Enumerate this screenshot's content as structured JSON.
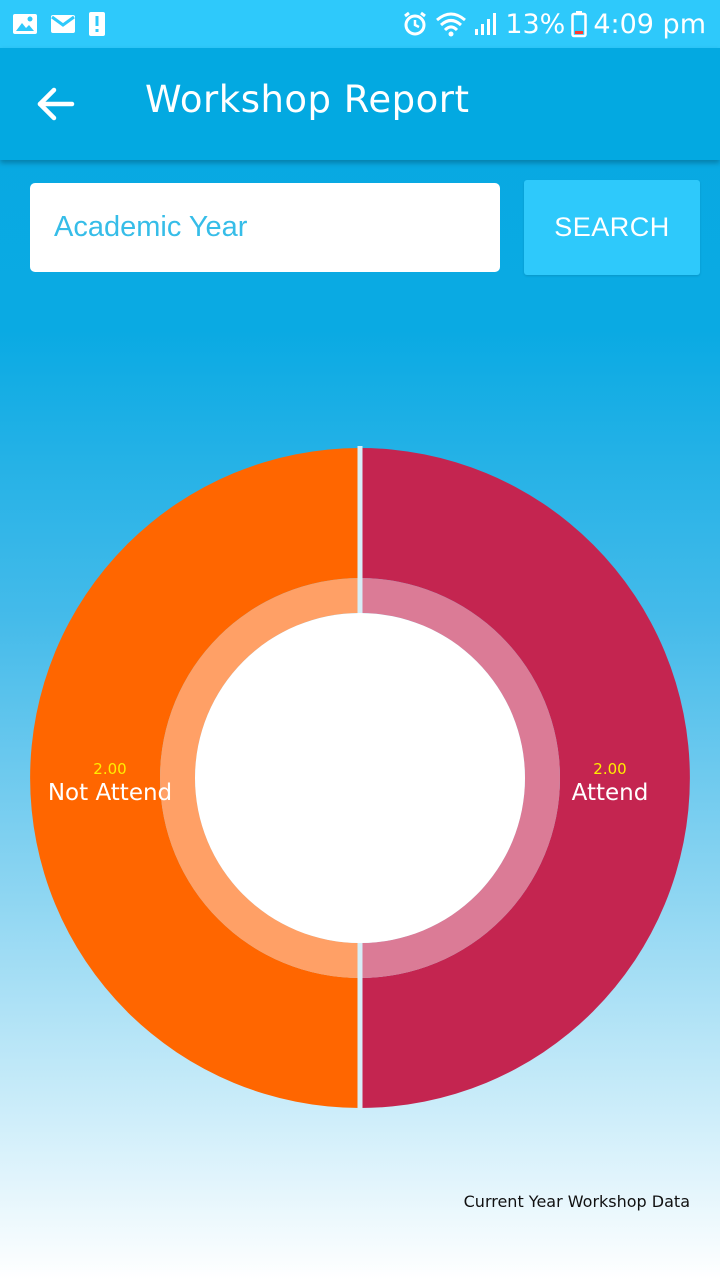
{
  "status_bar": {
    "battery_percent": "13%",
    "time": "4:09 pm",
    "icons": [
      "gallery-icon",
      "gmail-icon",
      "alert-icon",
      "alarm-icon",
      "wifi-icon",
      "signal-icon",
      "battery-icon"
    ]
  },
  "app_bar": {
    "title": "Workshop Report",
    "back_icon": "arrow-left-icon"
  },
  "search": {
    "placeholder": "Academic Year",
    "value": "",
    "button_label": "SEARCH"
  },
  "colors": {
    "app_bar": "#03a9e1",
    "status_bar": "#2ec9fb",
    "not_attend": "#ff6600",
    "not_attend_inner": "#ffa066",
    "attend": "#c42550",
    "attend_inner": "#db7b96",
    "value_label": "#ffee00"
  },
  "chart_data": {
    "type": "pie",
    "style": "donut",
    "slices": [
      {
        "label": "Attend",
        "value": 2.0,
        "value_label": "2.00",
        "color": "#c42550"
      },
      {
        "label": "Not Attend",
        "value": 2.0,
        "value_label": "2.00",
        "color": "#ff6600"
      }
    ],
    "center_text": ""
  },
  "footer": {
    "note": "Current Year Workshop Data"
  }
}
